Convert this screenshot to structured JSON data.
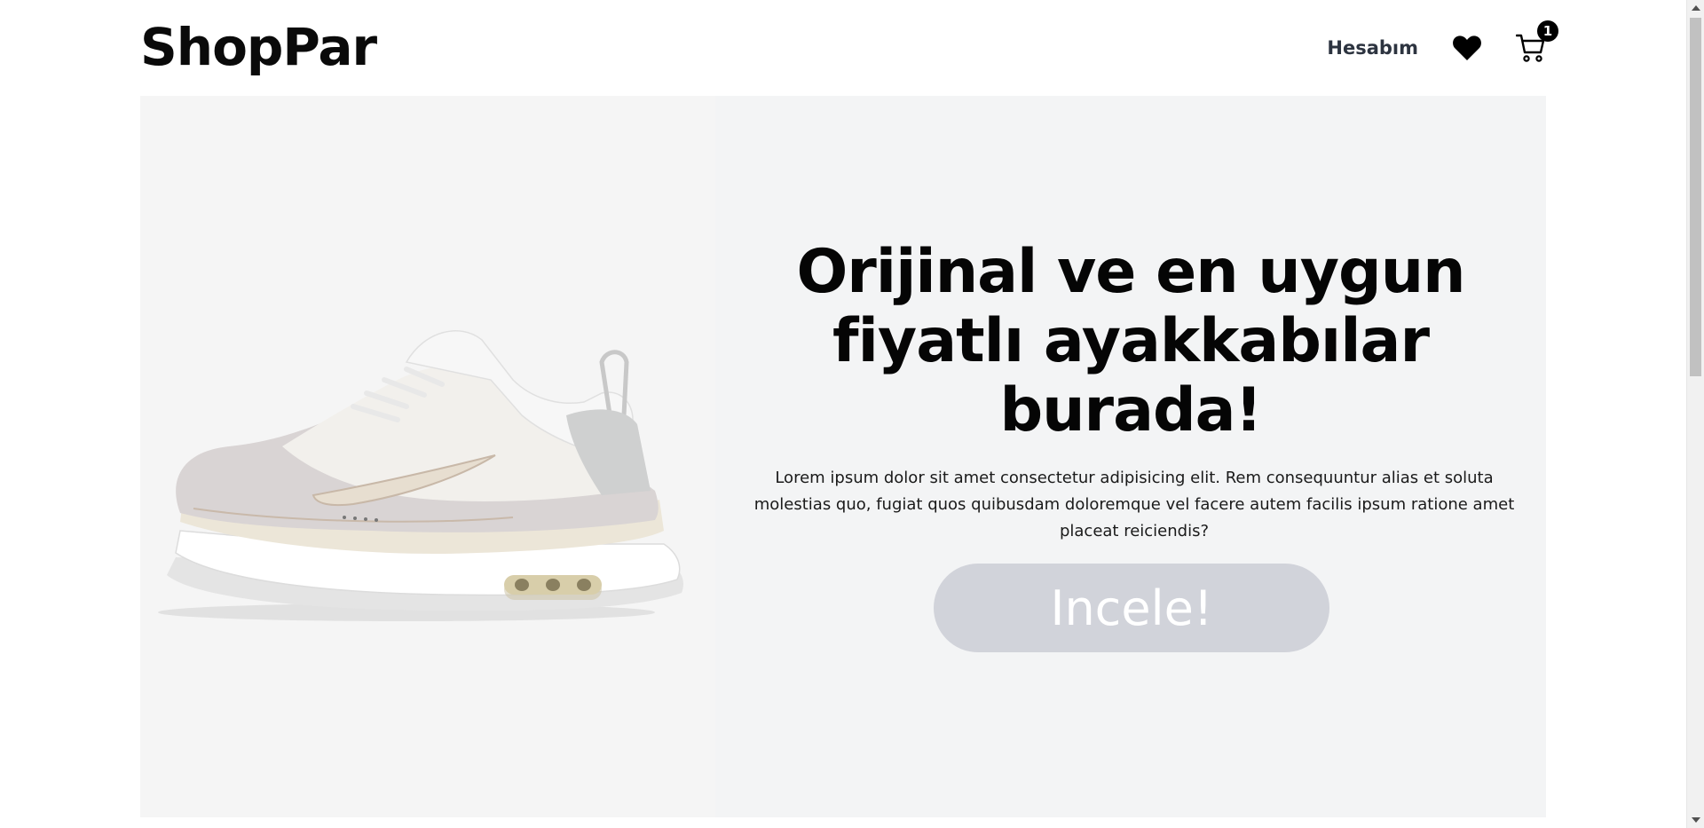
{
  "header": {
    "logo": "ShopPar",
    "nav": {
      "account_label": "Hesabım",
      "wishlist_icon": "heart-icon",
      "cart_icon": "cart-icon",
      "cart_count": "1"
    }
  },
  "hero": {
    "image_alt": "sneaker-image",
    "title": "Orijinal ve en uygun fiyatlı ayakkabılar burada!",
    "description": "Lorem ipsum dolor sit amet consectetur adipisicing elit. Rem consequuntur alias et soluta molestias quo, fugiat quos quibusdam doloremque vel facere autem facilis ipsum ratione amet placeat reiciendis?",
    "button_label": "Incele!"
  },
  "colors": {
    "hero_background": "#f3f4f5",
    "button_background": "#d1d3da",
    "button_text": "#ffffff",
    "nav_text": "#2d3440"
  }
}
